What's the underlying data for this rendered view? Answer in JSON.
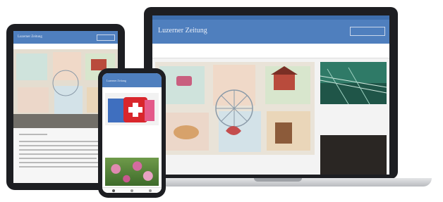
{
  "laptop": {
    "logo": "Luzerner Zeitung",
    "login_label": "",
    "nav_items": [
      "",
      "",
      "",
      "",
      "",
      "",
      "",
      "",
      ""
    ],
    "headline": "",
    "side_story": "",
    "ad_text": "",
    "accent_color": "#4f7fbe"
  },
  "tablet": {
    "logo": "Luzerner Zeitung"
  },
  "phone": {
    "logo": "Luzerner Zeitung",
    "headline": ""
  }
}
